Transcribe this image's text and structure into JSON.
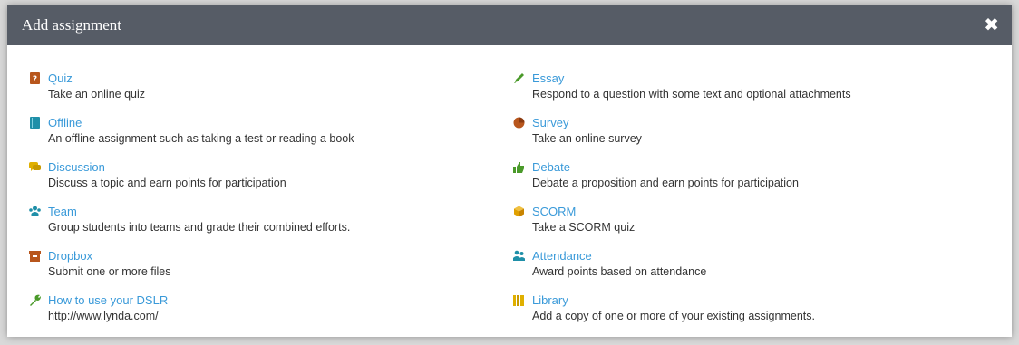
{
  "dialog": {
    "title": "Add assignment",
    "close_glyph": "✖"
  },
  "left_items": [
    {
      "label": "Quiz",
      "desc": "Take an online quiz",
      "icon": "quiz-icon",
      "color": "#b8561c"
    },
    {
      "label": "Offline",
      "desc": "An offline assignment such as taking a test or reading a book",
      "icon": "book-icon",
      "color": "#1f8fa8"
    },
    {
      "label": "Discussion",
      "desc": "Discuss a topic and earn points for participation",
      "icon": "chat-icon",
      "color": "#e0b000"
    },
    {
      "label": "Team",
      "desc": "Group students into teams and grade their combined efforts.",
      "icon": "team-icon",
      "color": "#1f8fa8"
    },
    {
      "label": "Dropbox",
      "desc": "Submit one or more files",
      "icon": "dropbox-icon",
      "color": "#b8561c"
    },
    {
      "label": "How to use your DSLR",
      "desc": "http://www.lynda.com/",
      "icon": "wrench-icon",
      "color": "#4a9a2a"
    }
  ],
  "right_items": [
    {
      "label": "Essay",
      "desc": "Respond to a question with some text and optional attachments",
      "icon": "pencil-icon",
      "color": "#4a9a2a"
    },
    {
      "label": "Survey",
      "desc": "Take an online survey",
      "icon": "pie-chart-icon",
      "color": "#b8561c"
    },
    {
      "label": "Debate",
      "desc": "Debate a proposition and earn points for participation",
      "icon": "thumbs-up-icon",
      "color": "#4a9a2a"
    },
    {
      "label": "SCORM",
      "desc": "Take a SCORM quiz",
      "icon": "cube-icon",
      "color": "#e0a000"
    },
    {
      "label": "Attendance",
      "desc": "Award points based on attendance",
      "icon": "people-icon",
      "color": "#1f8fa8"
    },
    {
      "label": "Library",
      "desc": "Add a copy of one or more of your existing assignments.",
      "icon": "library-icon",
      "color": "#e0b000"
    }
  ]
}
